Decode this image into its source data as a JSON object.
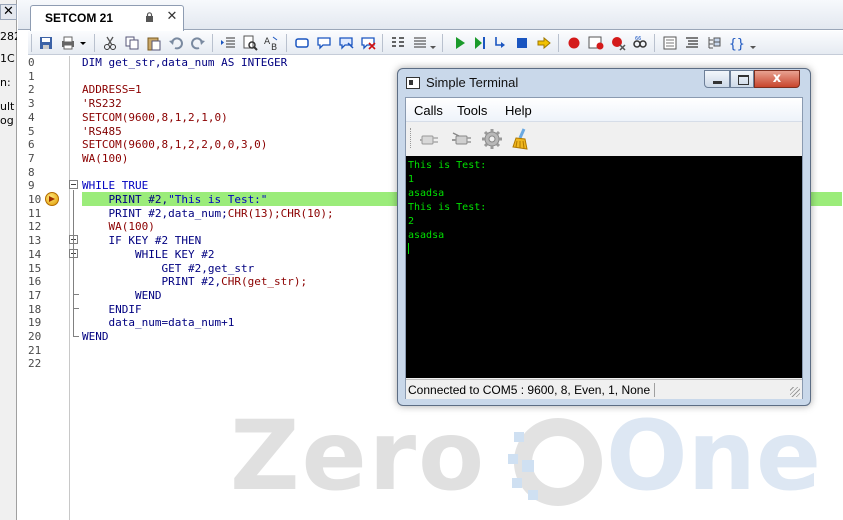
{
  "left_panel": {
    "close_glyph": "✕",
    "fragments": [
      "282",
      "1C",
      "n:",
      "ult",
      "og"
    ]
  },
  "tab": {
    "label": "SETCOM 21",
    "close_glyph": "✕"
  },
  "editor": {
    "line_numbers": [
      "0",
      "1",
      "2",
      "3",
      "4",
      "5",
      "6",
      "7",
      "8",
      "9",
      "10",
      "11",
      "12",
      "13",
      "14",
      "15",
      "16",
      "17",
      "18",
      "19",
      "20",
      "21",
      "22"
    ],
    "lines": [
      [
        {
          "t": "DIM get_str,data_num AS INTEGER",
          "c": "kw"
        }
      ],
      [],
      [
        {
          "t": "ADDRESS=1",
          "c": "fn"
        }
      ],
      [
        {
          "t": "'RS232",
          "c": "cm"
        }
      ],
      [
        {
          "t": "SETCOM(9600,8,1,2,1,0)",
          "c": "fn"
        }
      ],
      [
        {
          "t": "'RS485",
          "c": "cm"
        }
      ],
      [
        {
          "t": "SETCOM(9600,8,1,2,2,0,0,3,0)",
          "c": "fn"
        }
      ],
      [
        {
          "t": "WA(100)",
          "c": "fn"
        }
      ],
      [],
      [
        {
          "t": "WHILE TRUE",
          "c": "kwb"
        }
      ],
      [
        {
          "t": "    PRINT #2,",
          "c": "kw"
        },
        {
          "t": "\"This is Test:\"",
          "c": "str"
        }
      ],
      [
        {
          "t": "    PRINT #2,data_num;",
          "c": "kw"
        },
        {
          "t": "CHR(13);CHR(10);",
          "c": "fn"
        }
      ],
      [
        {
          "t": "    WA(100)",
          "c": "fn"
        }
      ],
      [
        {
          "t": "    IF KEY #2 THEN",
          "c": "kw"
        }
      ],
      [
        {
          "t": "        WHILE KEY #2",
          "c": "kw"
        }
      ],
      [
        {
          "t": "            GET #2,get_str",
          "c": "kw"
        }
      ],
      [
        {
          "t": "            PRINT #2,",
          "c": "kw"
        },
        {
          "t": "CHR(get_str);",
          "c": "fn"
        }
      ],
      [
        {
          "t": "        WEND",
          "c": "kw"
        }
      ],
      [
        {
          "t": "    ENDIF",
          "c": "kw"
        }
      ],
      [
        {
          "t": "    data_num=data_num+1",
          "c": "kw"
        }
      ],
      [
        {
          "t": "WEND",
          "c": "kw"
        }
      ],
      [],
      []
    ]
  },
  "watermark": {
    "word1": "Zero",
    "word2": "One"
  },
  "terminal": {
    "title": "Simple Terminal",
    "menus": [
      "Calls",
      "Tools",
      "Help"
    ],
    "toolbar_icons": [
      "connect-icon",
      "disconnect-icon",
      "settings-gear-icon",
      "clear-broom-icon"
    ],
    "output_lines": [
      "This is Test:",
      "1",
      "asadsa",
      "This is Test:",
      "2",
      "asadsa"
    ],
    "status": "Connected to COM5 : 9600, 8, Even, 1, None",
    "close_glyph": "x"
  },
  "colors": {
    "highlight": "#9bec7a",
    "terminal_fg": "#00e000",
    "terminal_bg": "#000000"
  }
}
